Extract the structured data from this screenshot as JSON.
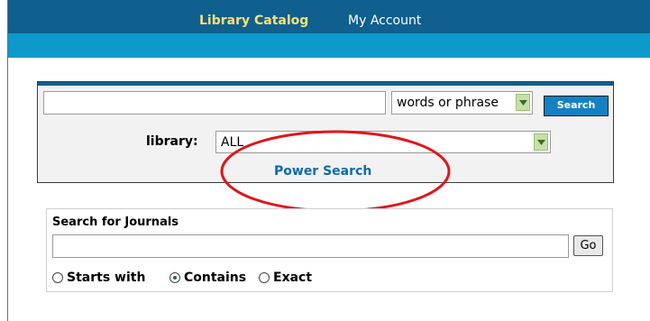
{
  "nav": {
    "catalog_label": "Library Catalog",
    "account_label": "My Account"
  },
  "search": {
    "keyword_value": "",
    "mode_selected": "words or phrase",
    "search_button_label": "Search",
    "library_label": "library:",
    "library_selected": "ALL",
    "power_search_label": "Power Search"
  },
  "journals": {
    "title": "Search for Journals",
    "input_value": "",
    "go_label": "Go",
    "options": [
      {
        "label": "Starts with",
        "selected": false
      },
      {
        "label": "Contains",
        "selected": true
      },
      {
        "label": "Exact",
        "selected": false
      }
    ]
  },
  "colors": {
    "nav_dark": "#0f5f8f",
    "nav_light": "#0d9acb",
    "catalog_link": "#f6e27a",
    "annotation": "#e0161b"
  }
}
